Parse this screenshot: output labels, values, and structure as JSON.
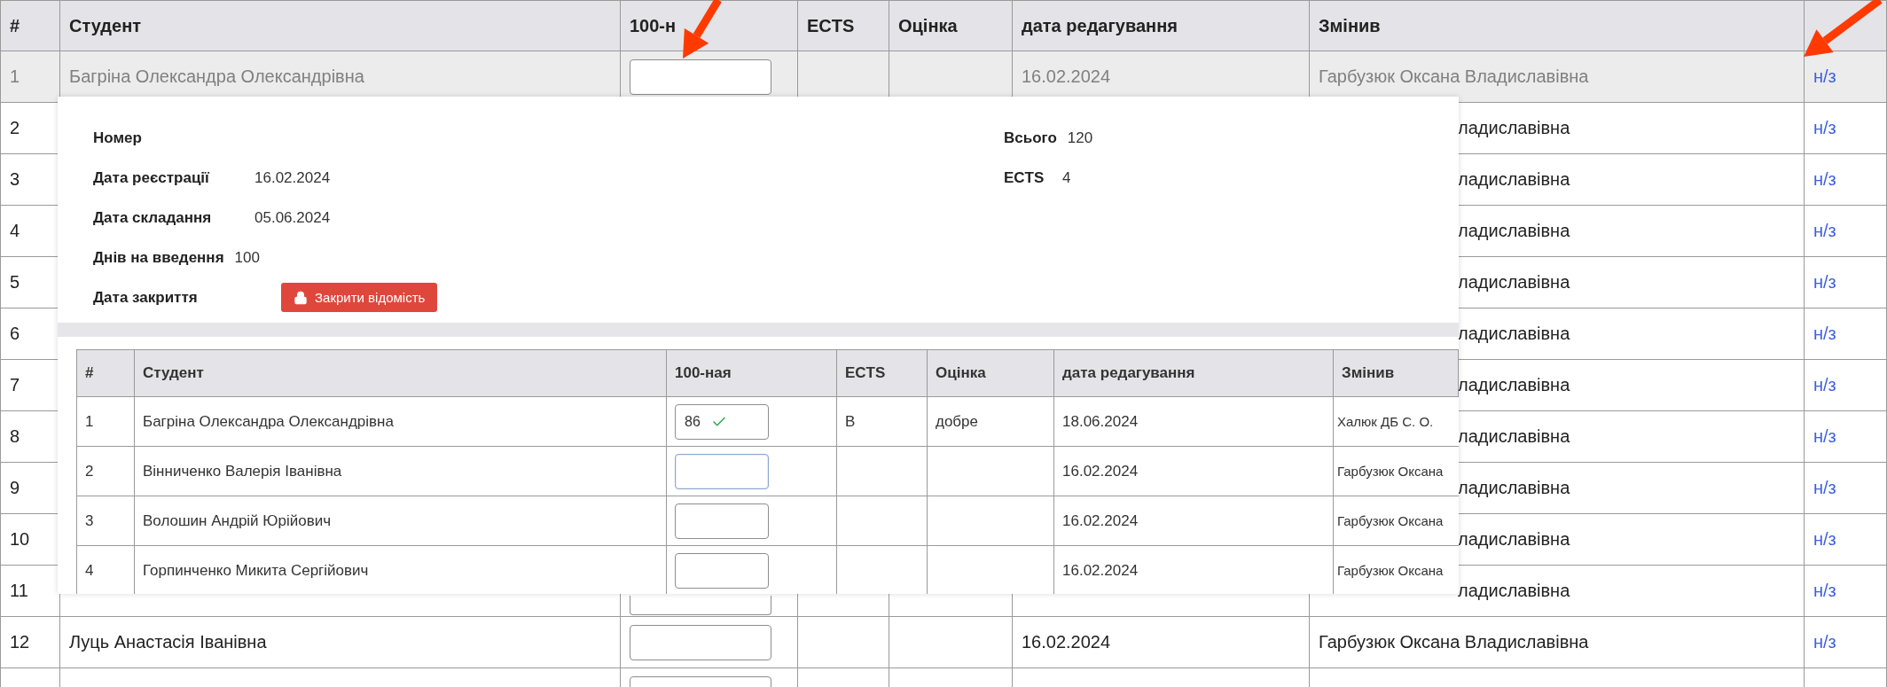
{
  "table": {
    "columns": [
      "#",
      "Студент",
      "100-н",
      "ECTS",
      "Оцінка",
      "дата редагування",
      "Змінив"
    ],
    "rows": [
      {
        "number": "1",
        "student": "Багріна Олександра Олександрівна",
        "score_field": true,
        "edited": "16.02.2024",
        "modified_by": "Гарбузюк Оксана Владиславівна",
        "link": "н/з",
        "muted": true,
        "covered": false
      },
      {
        "number": "2",
        "modified_by": "ладиславівна",
        "link": "н/з",
        "muted": false,
        "covered": true
      },
      {
        "number": "3",
        "modified_by": "ладиславівна",
        "link": "н/з",
        "muted": false,
        "covered": true
      },
      {
        "number": "4",
        "modified_by": "ладиславівна",
        "link": "н/з",
        "muted": false,
        "covered": true
      },
      {
        "number": "5",
        "modified_by": "ладиславівна",
        "link": "н/з",
        "muted": false,
        "covered": true
      },
      {
        "number": "6",
        "modified_by": "ладиславівна",
        "link": "н/з",
        "muted": false,
        "covered": true
      },
      {
        "number": "7",
        "modified_by": "ладиславівна",
        "link": "н/з",
        "muted": false,
        "covered": true
      },
      {
        "number": "8",
        "modified_by": "ладиславівна",
        "link": "н/з",
        "muted": false,
        "covered": true
      },
      {
        "number": "9",
        "modified_by": "ладиславівна",
        "link": "н/з",
        "muted": false,
        "covered": true
      },
      {
        "number": "10",
        "modified_by": "ладиславівна",
        "link": "н/з",
        "muted": false,
        "covered": true
      },
      {
        "number": "11",
        "score_field": true,
        "field_partly_hidden": true,
        "modified_by": "ладиславівна",
        "link": "н/з",
        "muted": false,
        "covered": true
      },
      {
        "number": "12",
        "student": "Луць Анастасія Іванівна",
        "score_field": true,
        "edited": "16.02.2024",
        "modified_by": "Гарбузюк Оксана Владиславівна",
        "link": "н/з",
        "muted": false,
        "covered": false
      },
      {
        "score_field": true,
        "muted": false
      }
    ]
  },
  "overlay": {
    "info": [
      {
        "label": "Номер"
      },
      {
        "label": "Дата реєстрації",
        "value": "16.02.2024"
      },
      {
        "label": "Дата складання",
        "value": "05.06.2024"
      },
      {
        "label": "Днів на введення",
        "value": "100"
      },
      {
        "label": "Дата закриття",
        "button": "Закрити відомість"
      }
    ],
    "totals": [
      {
        "label": "Всього",
        "value": "120"
      },
      {
        "label": "ECTS",
        "value": "4"
      }
    ],
    "table": {
      "columns": [
        "#",
        "Студент",
        "100-ная",
        "ECTS",
        "Оцінка",
        "дата редагування",
        "Змінив"
      ],
      "rows": [
        {
          "number": "1",
          "student": "Багріна Олександра Олександрівна",
          "score": "86",
          "valid": true,
          "focused": false,
          "ects": "B",
          "grade": "добре",
          "edited": "18.06.2024",
          "modified_by": "Халюк ДБ С. О."
        },
        {
          "number": "2",
          "student": "Вінниченко Валерія Іванівна",
          "valid": false,
          "focused": true,
          "edited": "16.02.2024",
          "modified_by": "Гарбузюк Оксана"
        },
        {
          "number": "3",
          "student": "Волошин Андрій Юрійович",
          "valid": false,
          "focused": false,
          "edited": "16.02.2024",
          "modified_by": "Гарбузюк Оксана"
        },
        {
          "number": "4",
          "student": "Горпинченко Микита Сергійович",
          "valid": false,
          "focused": false,
          "edited": "16.02.2024",
          "modified_by": "Гарбузюк Оксана"
        }
      ]
    }
  }
}
